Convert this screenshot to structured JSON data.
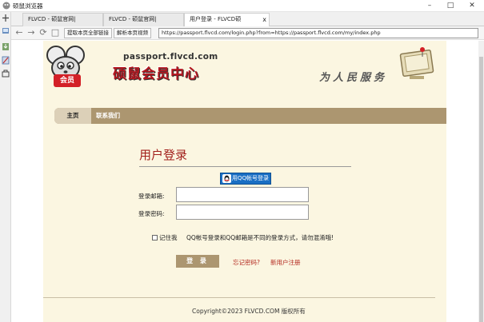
{
  "window": {
    "title": "硕鼠浏览器",
    "min": "–",
    "max": "□",
    "close": "✕"
  },
  "tabs": [
    {
      "label": "FLVCD - 硕鼠官网|"
    },
    {
      "label": "FLVCD - 硕鼠官网|"
    },
    {
      "label": "用户登录 - FLVCD硕",
      "close": "x"
    }
  ],
  "toolbar": {
    "back": "←",
    "forward": "→",
    "refresh": "⟳",
    "stop": "□",
    "extract_all_links": "提取本页全部链接",
    "parse_video": "解析本页视频",
    "url": "https://passport.flvcd.com/login.php?from=https://passport.flvcd.com/my/index.php"
  },
  "header": {
    "domain": "passport.flvcd.com",
    "site_title": "硕鼠会员中心",
    "member_badge": "会员",
    "slogan": "为人民服务"
  },
  "nav": {
    "home": "主页",
    "contact": "联系我们"
  },
  "login": {
    "title": "用户登录",
    "qq_button": "用QQ帐号登录",
    "email_label": "登录邮箱:",
    "password_label": "登录密码:",
    "email_value": "",
    "password_value": "",
    "remember_label": "记住我",
    "notice": "QQ帐号登录和QQ邮箱是不同的登录方式，请勿混淆哦!",
    "submit": "登 录",
    "forgot_password": "忘记密码?",
    "register": "新用户注册"
  },
  "footer": {
    "copyright": "Copyright©2023 FLVCD.COM 版权所有"
  },
  "colors": {
    "page_bg": "#fbf6e1",
    "nav_bar": "#ac9670",
    "nav_active": "#dcd0b8",
    "accent_red": "#a2201c",
    "qq_blue": "#1a6fc4"
  }
}
